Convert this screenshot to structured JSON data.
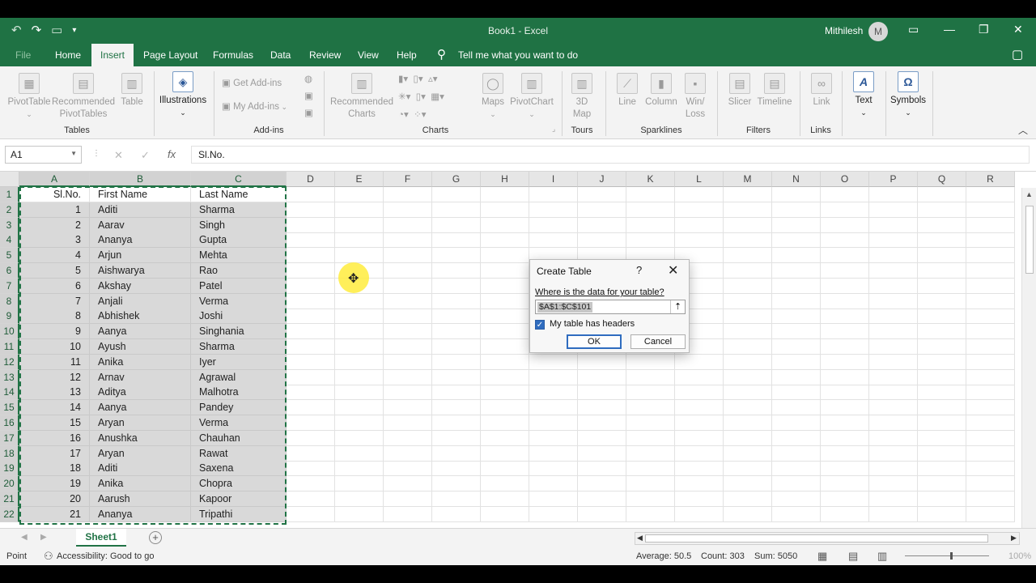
{
  "window": {
    "title": "Book1  -  Excel",
    "user_name": "Mithilesh",
    "user_initial": "M"
  },
  "tabs": [
    {
      "label": "File"
    },
    {
      "label": "Home"
    },
    {
      "label": "Insert"
    },
    {
      "label": "Page Layout"
    },
    {
      "label": "Formulas"
    },
    {
      "label": "Data"
    },
    {
      "label": "Review"
    },
    {
      "label": "View"
    },
    {
      "label": "Help"
    },
    {
      "label": "Tell me what you want to do"
    }
  ],
  "ribbon": {
    "tables": {
      "group": "Tables",
      "pivottable": "PivotTable",
      "recommended": "Recommended PivotTables",
      "table": "Table"
    },
    "illustrations": {
      "label": "Illustrations"
    },
    "addins": {
      "group": "Add-ins",
      "get": "Get Add-ins",
      "my": "My Add-ins"
    },
    "charts": {
      "group": "Charts",
      "recommended": "Recommended Charts",
      "maps": "Maps",
      "pivotchart": "PivotChart"
    },
    "tours": {
      "group": "Tours",
      "map3d": "3D Map"
    },
    "sparklines": {
      "group": "Sparklines",
      "line": "Line",
      "column": "Column",
      "winloss": "Win/ Loss"
    },
    "filters": {
      "group": "Filters",
      "slicer": "Slicer",
      "timeline": "Timeline"
    },
    "links": {
      "group": "Links",
      "link": "Link"
    },
    "text": {
      "label": "Text"
    },
    "symbols": {
      "label": "Symbols"
    }
  },
  "formula_bar": {
    "name_box": "A1",
    "content": "Sl.No."
  },
  "columns": [
    "A",
    "B",
    "C",
    "D",
    "E",
    "F",
    "G",
    "H",
    "I",
    "J",
    "K",
    "L",
    "M",
    "N",
    "O",
    "P",
    "Q",
    "R"
  ],
  "header_row": {
    "a": "Sl.No.",
    "b": "First Name",
    "c": "Last Name"
  },
  "rows": [
    {
      "n": "2",
      "a": "1",
      "b": "Aditi",
      "c": "Sharma"
    },
    {
      "n": "3",
      "a": "2",
      "b": "Aarav",
      "c": "Singh"
    },
    {
      "n": "4",
      "a": "3",
      "b": "Ananya",
      "c": "Gupta"
    },
    {
      "n": "5",
      "a": "4",
      "b": "Arjun",
      "c": "Mehta"
    },
    {
      "n": "6",
      "a": "5",
      "b": "Aishwarya",
      "c": "Rao"
    },
    {
      "n": "7",
      "a": "6",
      "b": "Akshay",
      "c": "Patel"
    },
    {
      "n": "8",
      "a": "7",
      "b": "Anjali",
      "c": "Verma"
    },
    {
      "n": "9",
      "a": "8",
      "b": "Abhishek",
      "c": "Joshi"
    },
    {
      "n": "10",
      "a": "9",
      "b": "Aanya",
      "c": "Singhania"
    },
    {
      "n": "11",
      "a": "10",
      "b": "Ayush",
      "c": "Sharma"
    },
    {
      "n": "12",
      "a": "11",
      "b": "Anika",
      "c": "Iyer"
    },
    {
      "n": "13",
      "a": "12",
      "b": "Arnav",
      "c": "Agrawal"
    },
    {
      "n": "14",
      "a": "13",
      "b": "Aditya",
      "c": "Malhotra"
    },
    {
      "n": "15",
      "a": "14",
      "b": "Aanya",
      "c": "Pandey"
    },
    {
      "n": "16",
      "a": "15",
      "b": "Aryan",
      "c": "Verma"
    },
    {
      "n": "17",
      "a": "16",
      "b": "Anushka",
      "c": "Chauhan"
    },
    {
      "n": "18",
      "a": "17",
      "b": "Aryan",
      "c": "Rawat"
    },
    {
      "n": "19",
      "a": "18",
      "b": "Aditi",
      "c": "Saxena"
    },
    {
      "n": "20",
      "a": "19",
      "b": "Anika",
      "c": "Chopra"
    },
    {
      "n": "21",
      "a": "20",
      "b": "Aarush",
      "c": "Kapoor"
    },
    {
      "n": "22",
      "a": "21",
      "b": "Ananya",
      "c": "Tripathi"
    }
  ],
  "sheet": {
    "tab": "Sheet1"
  },
  "status": {
    "mode": "Point",
    "accessibility": "Accessibility: Good to go",
    "average": "Average: 50.5",
    "count": "Count: 303",
    "sum": "Sum: 5050",
    "zoom": "100%"
  },
  "dialog": {
    "title": "Create Table",
    "help": "?",
    "prompt": "Where is the data for your table?",
    "range": "$A$1:$C$101",
    "checkbox_label": "My table has headers",
    "checkbox_checked": true,
    "ok": "OK",
    "cancel": "Cancel"
  },
  "colors": {
    "excel_green": "#1f7244",
    "selection_gray": "#d9d9d9",
    "accent_blue": "#2f6cbf"
  }
}
